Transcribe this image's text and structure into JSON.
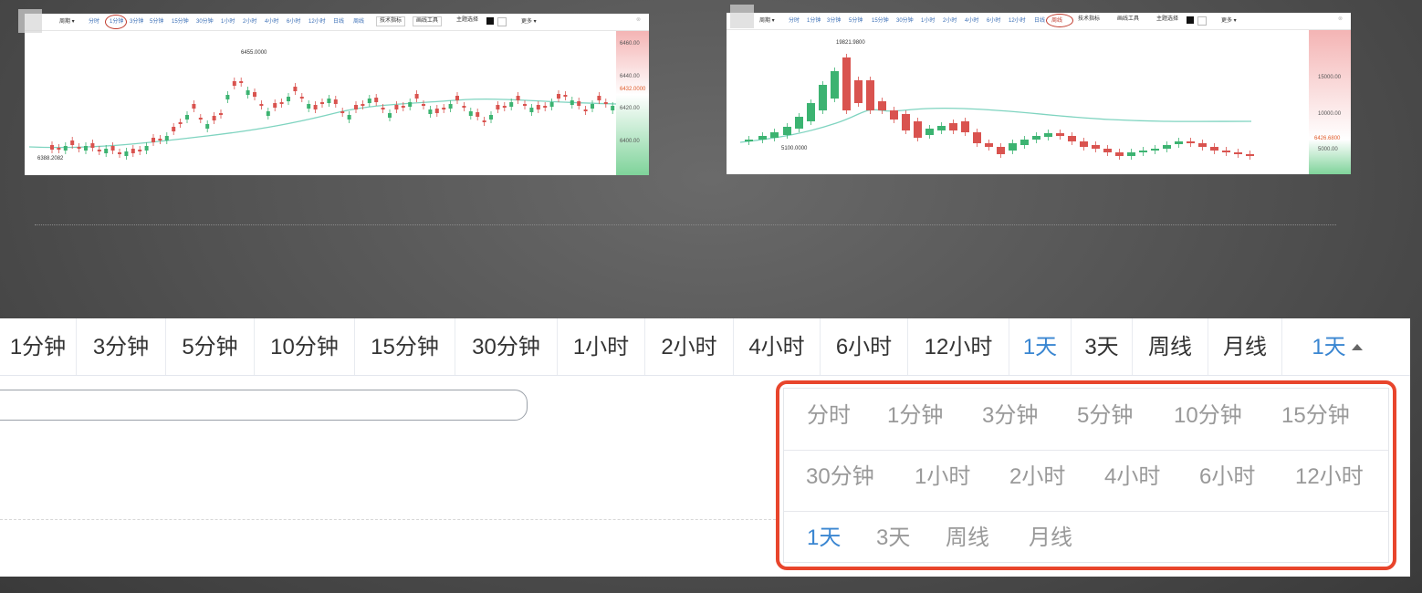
{
  "screenshot_left": {
    "toolbar": [
      "周期 ▾",
      "分时",
      "1分钟",
      "3分钟",
      "5分钟",
      "15分钟",
      "30分钟",
      "1小时",
      "2小时",
      "4小时",
      "6小时",
      "12小时",
      "日线",
      "周线"
    ],
    "boxes": [
      "技术指标",
      "画线工具",
      "主题选择"
    ],
    "more": "更多 ▾",
    "high_label": "6455.0000",
    "low_label": "6388.2082",
    "axis": [
      "6460.00",
      "6440.00",
      "6432.0000",
      "6420.00",
      "6400.00"
    ]
  },
  "screenshot_right": {
    "toolbar": [
      "周期 ▾",
      "分时",
      "1分钟",
      "3分钟",
      "5分钟",
      "15分钟",
      "30分钟",
      "1小时",
      "2小时",
      "4小时",
      "6小时",
      "12小时",
      "日线",
      "周线"
    ],
    "boxes": [
      "技术指标",
      "画线工具",
      "主题选择"
    ],
    "more": "更多 ▾",
    "high_label": "19821.9800",
    "low_label": "5100.0000",
    "axis": [
      "15000.00",
      "10000.00",
      "6426.6800",
      "5000.00"
    ]
  },
  "period_bar": {
    "tabs": [
      "1分钟",
      "3分钟",
      "5分钟",
      "10分钟",
      "15分钟",
      "30分钟",
      "1小时",
      "2小时",
      "4小时",
      "6小时",
      "12小时",
      "1天",
      "3天",
      "周线",
      "月线"
    ],
    "active": "1天",
    "dropdown_label": "1天"
  },
  "dropdown": {
    "row1": [
      "分时",
      "1分钟",
      "3分钟",
      "5分钟",
      "10分钟",
      "15分钟"
    ],
    "row2": [
      "30分钟",
      "1小时",
      "2小时",
      "4小时",
      "6小时",
      "12小时"
    ],
    "row3": [
      "1天",
      "3天",
      "周线",
      "月线"
    ],
    "active": "1天"
  },
  "colors": {
    "up": "#3cb371",
    "down": "#d9534f",
    "accent": "#3a86d1",
    "highlight_border": "#e8452c"
  }
}
